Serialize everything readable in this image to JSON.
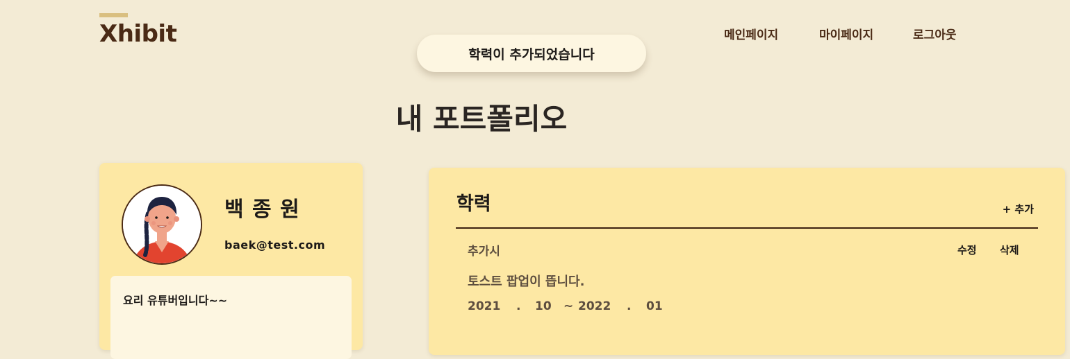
{
  "header": {
    "logo": "Xhibit",
    "nav": [
      {
        "label": "메인페이지"
      },
      {
        "label": "마이페이지"
      },
      {
        "label": "로그아웃"
      }
    ]
  },
  "toast": {
    "message": "학력이 추가되었습니다"
  },
  "page": {
    "title": "내 포트폴리오"
  },
  "profile": {
    "name": "백 종 원",
    "email": "baek@test.com",
    "bio": "요리 유튜버입니다~~"
  },
  "education": {
    "title": "학력",
    "add_label": "+ 추가",
    "entry": {
      "school": "추가시",
      "major": "토스트 팝업이 뜹니다.",
      "edit_label": "수정",
      "delete_label": "삭제",
      "start_year": "2021",
      "start_month": "10",
      "end_year": "2022",
      "end_month": "01",
      "dot": ".",
      "tilde": "~"
    }
  },
  "colors": {
    "background": "#f3ebd5",
    "card": "#fde8a4",
    "brown": "#4a2a15",
    "logo_accent": "#d9bf80"
  }
}
